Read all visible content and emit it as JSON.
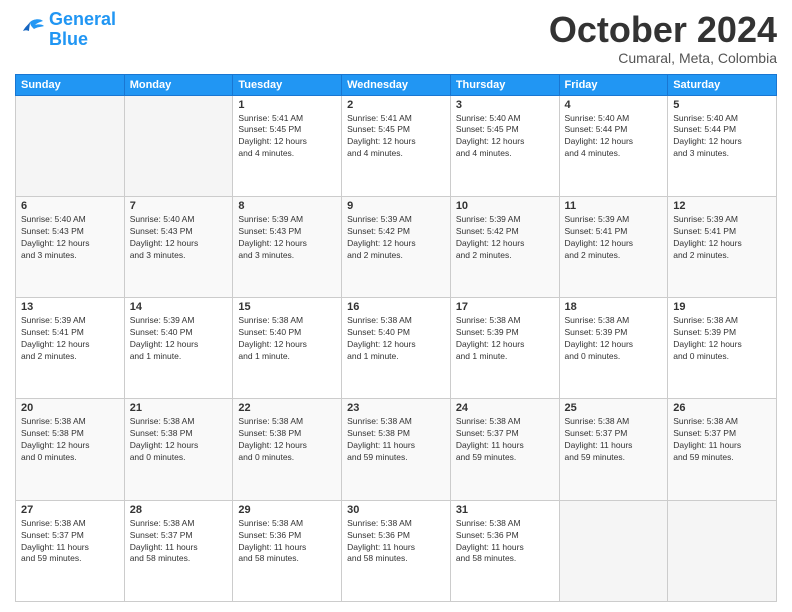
{
  "logo": {
    "line1": "General",
    "line2": "Blue"
  },
  "title": "October 2024",
  "location": "Cumaral, Meta, Colombia",
  "days_header": [
    "Sunday",
    "Monday",
    "Tuesday",
    "Wednesday",
    "Thursday",
    "Friday",
    "Saturday"
  ],
  "weeks": [
    [
      {
        "num": "",
        "info": ""
      },
      {
        "num": "",
        "info": ""
      },
      {
        "num": "1",
        "info": "Sunrise: 5:41 AM\nSunset: 5:45 PM\nDaylight: 12 hours\nand 4 minutes."
      },
      {
        "num": "2",
        "info": "Sunrise: 5:41 AM\nSunset: 5:45 PM\nDaylight: 12 hours\nand 4 minutes."
      },
      {
        "num": "3",
        "info": "Sunrise: 5:40 AM\nSunset: 5:45 PM\nDaylight: 12 hours\nand 4 minutes."
      },
      {
        "num": "4",
        "info": "Sunrise: 5:40 AM\nSunset: 5:44 PM\nDaylight: 12 hours\nand 4 minutes."
      },
      {
        "num": "5",
        "info": "Sunrise: 5:40 AM\nSunset: 5:44 PM\nDaylight: 12 hours\nand 3 minutes."
      }
    ],
    [
      {
        "num": "6",
        "info": "Sunrise: 5:40 AM\nSunset: 5:43 PM\nDaylight: 12 hours\nand 3 minutes."
      },
      {
        "num": "7",
        "info": "Sunrise: 5:40 AM\nSunset: 5:43 PM\nDaylight: 12 hours\nand 3 minutes."
      },
      {
        "num": "8",
        "info": "Sunrise: 5:39 AM\nSunset: 5:43 PM\nDaylight: 12 hours\nand 3 minutes."
      },
      {
        "num": "9",
        "info": "Sunrise: 5:39 AM\nSunset: 5:42 PM\nDaylight: 12 hours\nand 2 minutes."
      },
      {
        "num": "10",
        "info": "Sunrise: 5:39 AM\nSunset: 5:42 PM\nDaylight: 12 hours\nand 2 minutes."
      },
      {
        "num": "11",
        "info": "Sunrise: 5:39 AM\nSunset: 5:41 PM\nDaylight: 12 hours\nand 2 minutes."
      },
      {
        "num": "12",
        "info": "Sunrise: 5:39 AM\nSunset: 5:41 PM\nDaylight: 12 hours\nand 2 minutes."
      }
    ],
    [
      {
        "num": "13",
        "info": "Sunrise: 5:39 AM\nSunset: 5:41 PM\nDaylight: 12 hours\nand 2 minutes."
      },
      {
        "num": "14",
        "info": "Sunrise: 5:39 AM\nSunset: 5:40 PM\nDaylight: 12 hours\nand 1 minute."
      },
      {
        "num": "15",
        "info": "Sunrise: 5:38 AM\nSunset: 5:40 PM\nDaylight: 12 hours\nand 1 minute."
      },
      {
        "num": "16",
        "info": "Sunrise: 5:38 AM\nSunset: 5:40 PM\nDaylight: 12 hours\nand 1 minute."
      },
      {
        "num": "17",
        "info": "Sunrise: 5:38 AM\nSunset: 5:39 PM\nDaylight: 12 hours\nand 1 minute."
      },
      {
        "num": "18",
        "info": "Sunrise: 5:38 AM\nSunset: 5:39 PM\nDaylight: 12 hours\nand 0 minutes."
      },
      {
        "num": "19",
        "info": "Sunrise: 5:38 AM\nSunset: 5:39 PM\nDaylight: 12 hours\nand 0 minutes."
      }
    ],
    [
      {
        "num": "20",
        "info": "Sunrise: 5:38 AM\nSunset: 5:38 PM\nDaylight: 12 hours\nand 0 minutes."
      },
      {
        "num": "21",
        "info": "Sunrise: 5:38 AM\nSunset: 5:38 PM\nDaylight: 12 hours\nand 0 minutes."
      },
      {
        "num": "22",
        "info": "Sunrise: 5:38 AM\nSunset: 5:38 PM\nDaylight: 12 hours\nand 0 minutes."
      },
      {
        "num": "23",
        "info": "Sunrise: 5:38 AM\nSunset: 5:38 PM\nDaylight: 11 hours\nand 59 minutes."
      },
      {
        "num": "24",
        "info": "Sunrise: 5:38 AM\nSunset: 5:37 PM\nDaylight: 11 hours\nand 59 minutes."
      },
      {
        "num": "25",
        "info": "Sunrise: 5:38 AM\nSunset: 5:37 PM\nDaylight: 11 hours\nand 59 minutes."
      },
      {
        "num": "26",
        "info": "Sunrise: 5:38 AM\nSunset: 5:37 PM\nDaylight: 11 hours\nand 59 minutes."
      }
    ],
    [
      {
        "num": "27",
        "info": "Sunrise: 5:38 AM\nSunset: 5:37 PM\nDaylight: 11 hours\nand 59 minutes."
      },
      {
        "num": "28",
        "info": "Sunrise: 5:38 AM\nSunset: 5:37 PM\nDaylight: 11 hours\nand 58 minutes."
      },
      {
        "num": "29",
        "info": "Sunrise: 5:38 AM\nSunset: 5:36 PM\nDaylight: 11 hours\nand 58 minutes."
      },
      {
        "num": "30",
        "info": "Sunrise: 5:38 AM\nSunset: 5:36 PM\nDaylight: 11 hours\nand 58 minutes."
      },
      {
        "num": "31",
        "info": "Sunrise: 5:38 AM\nSunset: 5:36 PM\nDaylight: 11 hours\nand 58 minutes."
      },
      {
        "num": "",
        "info": ""
      },
      {
        "num": "",
        "info": ""
      }
    ]
  ]
}
